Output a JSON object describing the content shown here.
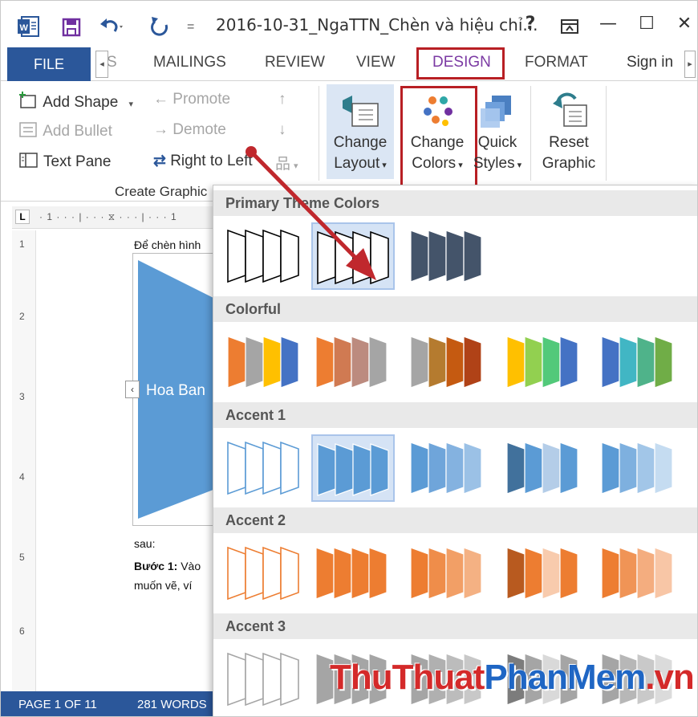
{
  "title_bar": {
    "document_title": "2016-10-31_NgaTTN_Chèn và hiệu chỉ...",
    "help": "?",
    "ribbon_display": "⊼",
    "minimize": "—",
    "maximize": "☐",
    "close": "✕"
  },
  "tabs": {
    "file": "FILE",
    "partial": "S",
    "items": [
      "MAILINGS",
      "REVIEW",
      "VIEW",
      "DESIGN",
      "FORMAT"
    ],
    "active": "DESIGN",
    "sign_in": "Sign in"
  },
  "ribbon": {
    "create_graphic": {
      "add_shape": "Add Shape",
      "add_bullet": "Add Bullet",
      "text_pane": "Text Pane",
      "promote": "Promote",
      "demote": "Demote",
      "right_to_left": "Right to Left",
      "label": "Create Graphic"
    },
    "change_layout": [
      "Change",
      "Layout"
    ],
    "change_colors": [
      "Change",
      "Colors"
    ],
    "quick_styles": [
      "Quick",
      "Styles"
    ],
    "reset_graphic": [
      "Reset",
      "Graphic"
    ]
  },
  "document": {
    "line1": "Để chèn hình",
    "shape_text": "Hoa Ban",
    "line2": "sau:",
    "step_bold": "Bước 1:",
    "step_rest": " Vào",
    "line4": "muốn vẽ, ví"
  },
  "status_bar": {
    "page": "PAGE 1 OF 11",
    "words": "281 WORDS"
  },
  "gallery": {
    "sections": [
      {
        "title": "Primary Theme Colors",
        "swatches": [
          {
            "style": "outline",
            "colors": [
              "#000000",
              "#000000",
              "#000000",
              "#000000"
            ]
          },
          {
            "style": "outline",
            "colors": [
              "#000000",
              "#000000",
              "#000000",
              "#000000"
            ],
            "selected": true
          },
          {
            "style": "fill",
            "colors": [
              "#44546a",
              "#44546a",
              "#44546a",
              "#44546a"
            ]
          }
        ]
      },
      {
        "title": "Colorful",
        "swatches": [
          {
            "style": "fill",
            "colors": [
              "#ed7d31",
              "#a5a5a5",
              "#ffc000",
              "#4472c4"
            ]
          },
          {
            "style": "fill",
            "colors": [
              "#ed7d31",
              "#d07a52",
              "#bc8b7f",
              "#a5a5a5"
            ]
          },
          {
            "style": "fill",
            "colors": [
              "#a5a5a5",
              "#b57b2f",
              "#c55a11",
              "#b04217"
            ]
          },
          {
            "style": "fill",
            "colors": [
              "#ffc000",
              "#92d050",
              "#52c97a",
              "#4472c4"
            ]
          },
          {
            "style": "fill",
            "colors": [
              "#4472c4",
              "#41b6c4",
              "#4fb38a",
              "#70ad47"
            ]
          }
        ]
      },
      {
        "title": "Accent 1",
        "swatches": [
          {
            "style": "outline",
            "colors": [
              "#5b9bd5",
              "#5b9bd5",
              "#5b9bd5",
              "#5b9bd5"
            ]
          },
          {
            "style": "fill",
            "colors": [
              "#5b9bd5",
              "#5b9bd5",
              "#5b9bd5",
              "#5b9bd5"
            ],
            "selected": true
          },
          {
            "style": "fill",
            "colors": [
              "#5b9bd5",
              "#6fa5da",
              "#84b2e0",
              "#9bc1e6"
            ]
          },
          {
            "style": "fill",
            "colors": [
              "#41719c",
              "#5b9bd5",
              "#b4cde8",
              "#5b9bd5"
            ]
          },
          {
            "style": "fill",
            "colors": [
              "#5b9bd5",
              "#7eb0df",
              "#a2c6e8",
              "#c5dcf1"
            ]
          }
        ]
      },
      {
        "title": "Accent 2",
        "swatches": [
          {
            "style": "outline",
            "colors": [
              "#ed7d31",
              "#ed7d31",
              "#ed7d31",
              "#ed7d31"
            ]
          },
          {
            "style": "fill",
            "colors": [
              "#ed7d31",
              "#ed7d31",
              "#ed7d31",
              "#ed7d31"
            ]
          },
          {
            "style": "fill",
            "colors": [
              "#ed7d31",
              "#ef8d4a",
              "#f29f66",
              "#f4b183"
            ]
          },
          {
            "style": "fill",
            "colors": [
              "#b85a1f",
              "#ed7d31",
              "#f8cbad",
              "#ed7d31"
            ]
          },
          {
            "style": "fill",
            "colors": [
              "#ed7d31",
              "#f09456",
              "#f4ad7f",
              "#f8c6a6"
            ]
          }
        ]
      },
      {
        "title": "Accent 3",
        "swatches": [
          {
            "style": "outline",
            "colors": [
              "#a5a5a5",
              "#a5a5a5",
              "#a5a5a5",
              "#a5a5a5"
            ]
          },
          {
            "style": "fill",
            "colors": [
              "#a5a5a5",
              "#a5a5a5",
              "#a5a5a5",
              "#a5a5a5"
            ]
          },
          {
            "style": "fill",
            "colors": [
              "#a5a5a5",
              "#b0b0b0",
              "#bcbcbc",
              "#c8c8c8"
            ]
          },
          {
            "style": "fill",
            "colors": [
              "#7c7c7c",
              "#a5a5a5",
              "#d9d9d9",
              "#a5a5a5"
            ]
          },
          {
            "style": "fill",
            "colors": [
              "#a5a5a5",
              "#b7b7b7",
              "#c9c9c9",
              "#dbdbdb"
            ]
          }
        ]
      }
    ]
  },
  "watermark": {
    "thu_thuat": "ThuThuat",
    "phan_mem": "PhanMem",
    "vn": ".vn"
  },
  "colors": {
    "ribbon_blue": "#2b579a",
    "accent_red": "#b81f24",
    "design_purple": "#7b3aa3"
  }
}
